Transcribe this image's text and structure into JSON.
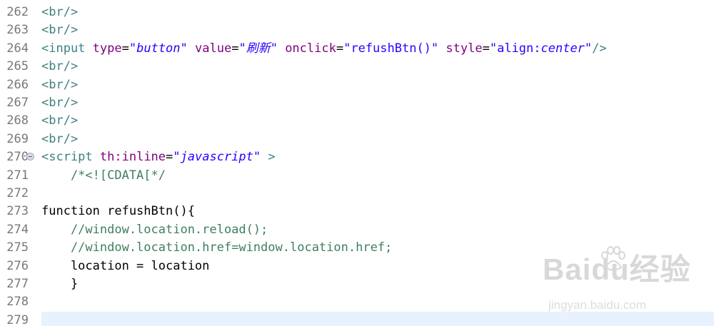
{
  "editor": {
    "lines": [
      {
        "num": "262",
        "parts": [
          {
            "cls": "tag",
            "text": "<br/>"
          }
        ]
      },
      {
        "num": "263",
        "parts": [
          {
            "cls": "tag",
            "text": "<br/>"
          }
        ]
      },
      {
        "num": "264",
        "parts": [
          {
            "cls": "tag",
            "text": "<input"
          },
          {
            "cls": "txt",
            "text": " "
          },
          {
            "cls": "attr",
            "text": "type"
          },
          {
            "cls": "eq",
            "text": "="
          },
          {
            "cls": "str",
            "text": "\"button\""
          },
          {
            "cls": "txt",
            "text": " "
          },
          {
            "cls": "attr",
            "text": "value"
          },
          {
            "cls": "eq",
            "text": "="
          },
          {
            "cls": "str",
            "text": "\"刷新\""
          },
          {
            "cls": "txt",
            "text": " "
          },
          {
            "cls": "attr",
            "text": "onclick"
          },
          {
            "cls": "eq",
            "text": "="
          },
          {
            "cls": "plainstr",
            "text": "\"refushBtn()\""
          },
          {
            "cls": "txt",
            "text": " "
          },
          {
            "cls": "attr",
            "text": "style"
          },
          {
            "cls": "eq",
            "text": "="
          },
          {
            "cls": "plainstr",
            "text": "\"align:"
          },
          {
            "cls": "str",
            "text": "center"
          },
          {
            "cls": "plainstr",
            "text": "\""
          },
          {
            "cls": "tag",
            "text": "/>"
          }
        ]
      },
      {
        "num": "265",
        "parts": [
          {
            "cls": "tag",
            "text": "<br/>"
          }
        ]
      },
      {
        "num": "266",
        "parts": [
          {
            "cls": "tag",
            "text": "<br/>"
          }
        ]
      },
      {
        "num": "267",
        "parts": [
          {
            "cls": "tag",
            "text": "<br/>"
          }
        ]
      },
      {
        "num": "268",
        "parts": [
          {
            "cls": "tag",
            "text": "<br/>"
          }
        ]
      },
      {
        "num": "269",
        "parts": [
          {
            "cls": "tag",
            "text": "<br/>"
          }
        ]
      },
      {
        "num": "270",
        "fold": true,
        "parts": [
          {
            "cls": "tag",
            "text": "<script"
          },
          {
            "cls": "txt",
            "text": " "
          },
          {
            "cls": "attr",
            "text": "th:inline"
          },
          {
            "cls": "eq",
            "text": "="
          },
          {
            "cls": "str",
            "text": "\"javascript\""
          },
          {
            "cls": "txt",
            "text": " "
          },
          {
            "cls": "tag",
            "text": ">"
          }
        ]
      },
      {
        "num": "271",
        "parts": [
          {
            "cls": "cmt",
            "text": "    /*<![CDATA[*/"
          }
        ]
      },
      {
        "num": "272",
        "parts": []
      },
      {
        "num": "273",
        "parts": [
          {
            "cls": "txt",
            "text": "function refushBtn(){"
          }
        ]
      },
      {
        "num": "274",
        "parts": [
          {
            "cls": "cmt",
            "text": "    //window.location.reload();"
          }
        ]
      },
      {
        "num": "275",
        "parts": [
          {
            "cls": "cmt",
            "text": "    //window.location.href=window.location.href;"
          }
        ]
      },
      {
        "num": "276",
        "parts": [
          {
            "cls": "txt",
            "text": "    location = location"
          }
        ]
      },
      {
        "num": "277",
        "parts": [
          {
            "cls": "txt",
            "text": "    }"
          }
        ]
      },
      {
        "num": "278",
        "parts": []
      },
      {
        "num": "279",
        "parts": [],
        "current": true
      }
    ]
  },
  "watermark": {
    "logo": "Baidu经验",
    "sub": "jingyan.baidu.com"
  }
}
